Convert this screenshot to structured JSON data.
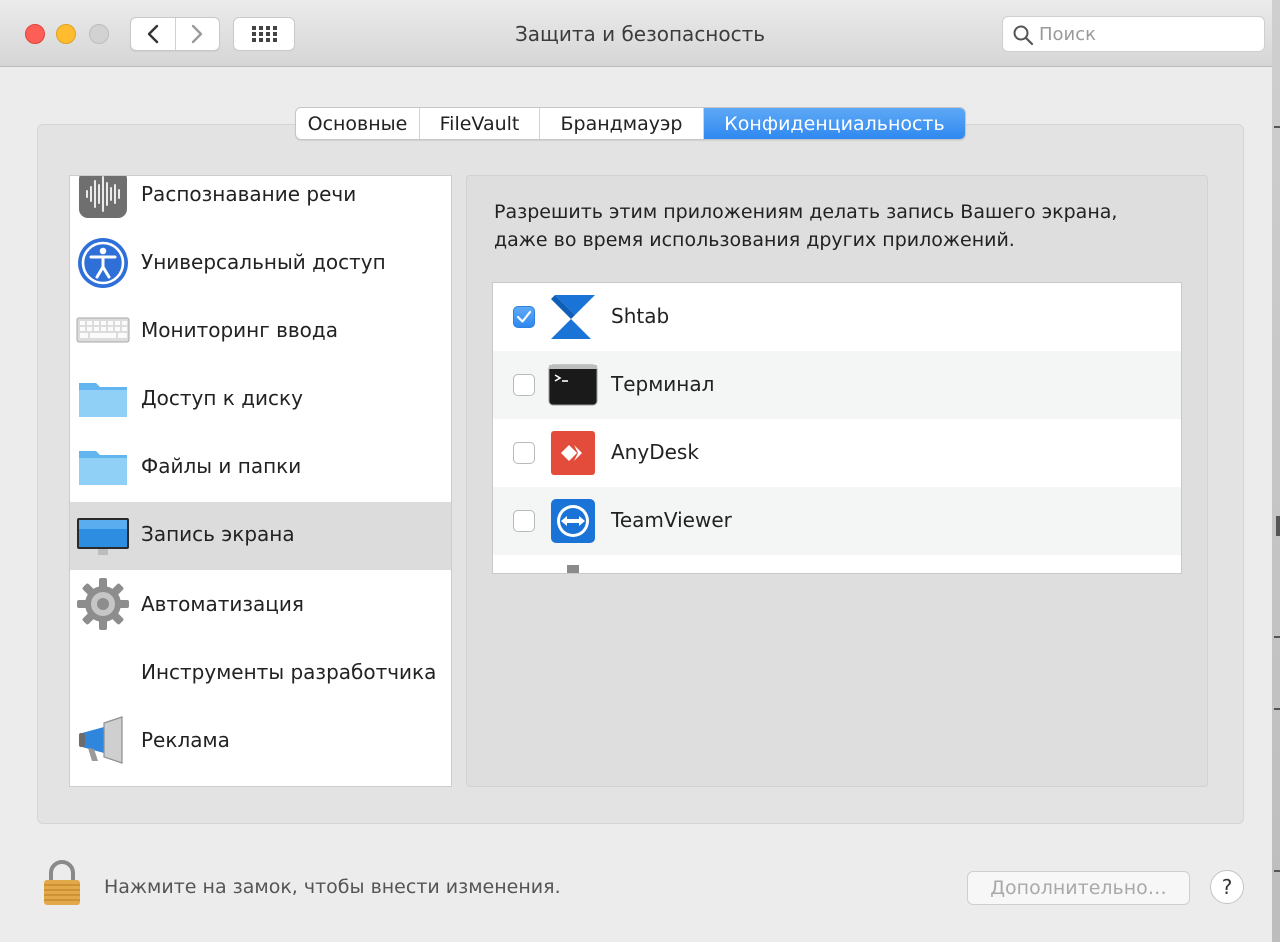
{
  "window": {
    "title": "Защита и безопасность"
  },
  "search": {
    "placeholder": "Поиск"
  },
  "tabs": [
    {
      "label": "Основные",
      "active": false
    },
    {
      "label": "FileVault",
      "active": false
    },
    {
      "label": "Брандмауэр",
      "active": false
    },
    {
      "label": "Конфиденциальность",
      "active": true
    }
  ],
  "sidebar": {
    "items": [
      {
        "label": "Распознавание речи",
        "icon": "speech-recognition-icon"
      },
      {
        "label": "Универсальный доступ",
        "icon": "accessibility-icon"
      },
      {
        "label": "Мониторинг ввода",
        "icon": "keyboard-icon"
      },
      {
        "label": "Доступ к диску",
        "icon": "folder-icon"
      },
      {
        "label": "Файлы и папки",
        "icon": "folder-icon"
      },
      {
        "label": "Запись экрана",
        "icon": "monitor-icon",
        "selected": true
      },
      {
        "label": "Автоматизация",
        "icon": "gear-icon"
      },
      {
        "label": "Инструменты разработчика",
        "icon": ""
      },
      {
        "label": "Реклама",
        "icon": "megaphone-icon"
      }
    ]
  },
  "main": {
    "description_line1": "Разрешить этим приложениям делать запись Вашего экрана,",
    "description_line2": "даже во время использования других приложений.",
    "apps": [
      {
        "name": "Shtab",
        "checked": true,
        "icon": "shtab-icon"
      },
      {
        "name": "Терминал",
        "checked": false,
        "icon": "terminal-icon"
      },
      {
        "name": "AnyDesk",
        "checked": false,
        "icon": "anydesk-icon"
      },
      {
        "name": "TeamViewer",
        "checked": false,
        "icon": "teamviewer-icon"
      }
    ]
  },
  "footer": {
    "lock_text": "Нажмите на замок, чтобы внести изменения.",
    "advanced_label": "Дополнительно…",
    "help_label": "?"
  },
  "colors": {
    "accent": "#2f88f0",
    "close": "#fd5f57",
    "minimize": "#febc2e",
    "anydesk": "#e34b3b",
    "teamviewer": "#1a73d6"
  }
}
